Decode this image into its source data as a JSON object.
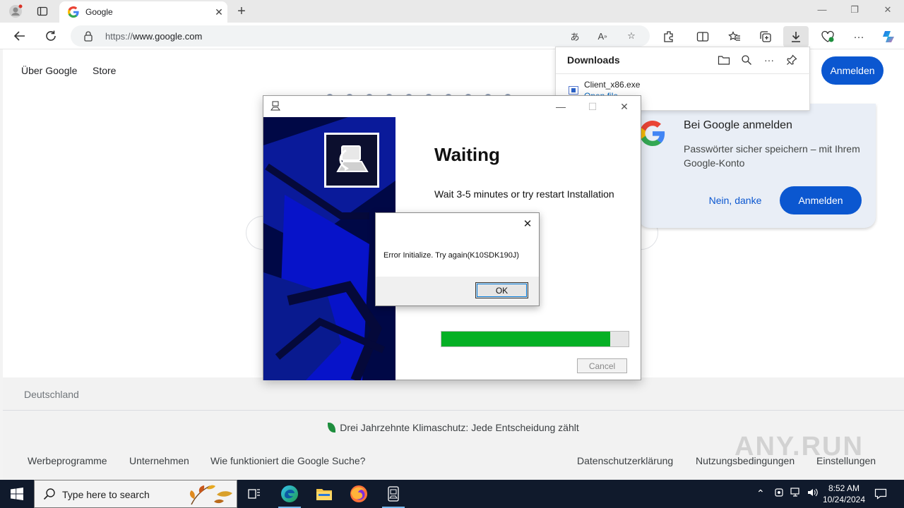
{
  "browser": {
    "tab_title": "Google",
    "url_prefix": "https://",
    "url_host": "www.google.com",
    "icons": [
      "profile-icon",
      "tab-actions-icon",
      "back-icon",
      "refresh-icon",
      "lock-icon",
      "read-aloud-icon",
      "favorite-icon",
      "extensions-icon",
      "split-screen-icon",
      "favorites-icon",
      "collections-icon",
      "downloads-icon",
      "browser-essentials-icon",
      "more-icon",
      "copilot-icon"
    ]
  },
  "google": {
    "top_links": [
      "Über Google",
      "Store"
    ],
    "signin_label": "Anmelden",
    "footer": {
      "country": "Deutschland",
      "climate": "Drei Jahrzehnte Klimaschutz: Jede Entscheidung zählt",
      "left_links": [
        "Werbeprogramme",
        "Unternehmen",
        "Wie funktioniert die Google Suche?"
      ],
      "right_links": [
        "Datenschutzerklärung",
        "Nutzungsbedingungen",
        "Einstellungen"
      ]
    }
  },
  "downloads": {
    "title": "Downloads",
    "file_name": "Client_x86.exe",
    "open_label": "Open file"
  },
  "signin_prompt": {
    "title": "Bei Google anmelden",
    "description": "Passwörter sicher speichern – mit Ihrem Google-Konto",
    "decline": "Nein, danke",
    "accept": "Anmelden"
  },
  "installer": {
    "heading": "Waiting",
    "subtitle": "Wait 3-5 minutes or try restart Installation",
    "progress": 0.9,
    "cancel": "Cancel",
    "colors": {
      "banner": "#000846",
      "progress": "#06b025"
    }
  },
  "error_dialog": {
    "message": "Error Initialize. Try again(K10SDK190J)",
    "ok": "OK"
  },
  "watermark": "ANY.RUN",
  "taskbar": {
    "search_placeholder": "Type here to search",
    "time": "8:52 AM",
    "date": "10/24/2024",
    "apps": [
      "task-view-icon",
      "edge-icon",
      "file-explorer-icon",
      "firefox-icon",
      "installer-app-icon"
    ]
  }
}
